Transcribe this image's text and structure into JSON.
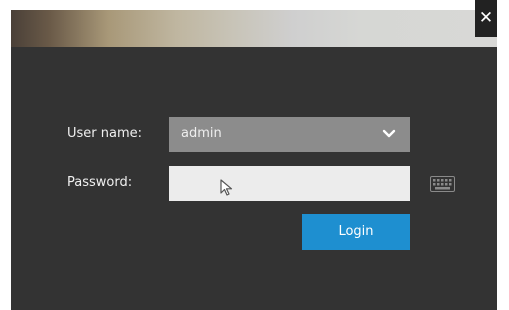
{
  "window": {
    "close_icon": "close-icon"
  },
  "form": {
    "username_label": "User name:",
    "username_value": "admin",
    "password_label": "Password:",
    "password_value": "",
    "login_label": "Login"
  },
  "icons": {
    "dropdown": "chevron-down-icon",
    "keyboard": "keyboard-icon",
    "cursor": "mouse-pointer-icon"
  },
  "colors": {
    "dialog_bg": "#333333",
    "accent": "#1e8fd0",
    "select_bg": "#8c8c8c",
    "input_bg": "#ececec"
  }
}
